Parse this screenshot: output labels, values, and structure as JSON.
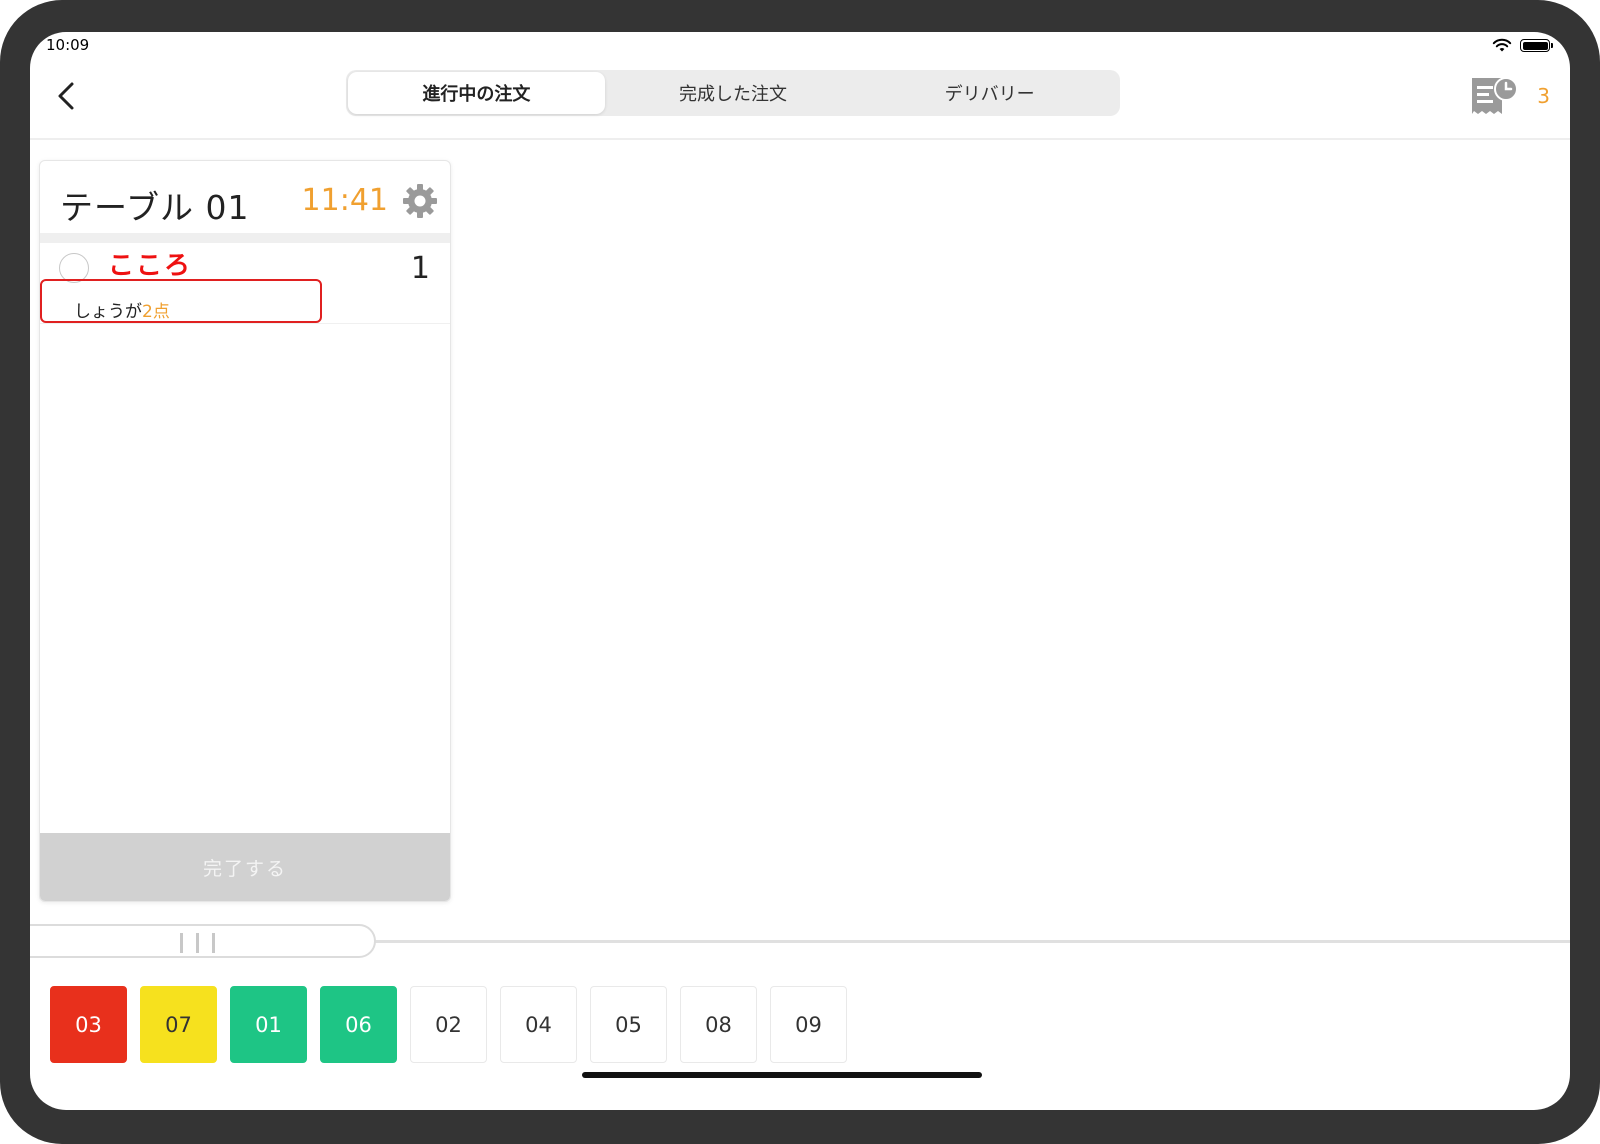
{
  "status_bar": {
    "time": "10:09"
  },
  "header": {
    "tabs": [
      {
        "label": "進行中の注文",
        "active": true
      },
      {
        "label": "完成した注文",
        "active": false
      },
      {
        "label": "デリバリー",
        "active": false
      }
    ],
    "receipt_count": "3"
  },
  "order_card": {
    "title": "テーブル  01",
    "time": "11:41",
    "item": {
      "name": "こころ",
      "quantity": "1",
      "option_text": "しょうが",
      "option_count": "2点"
    },
    "complete_label": "完了する"
  },
  "table_chips": [
    {
      "label": "03",
      "status": "red"
    },
    {
      "label": "07",
      "status": "yellow"
    },
    {
      "label": "01",
      "status": "green"
    },
    {
      "label": "06",
      "status": "green"
    },
    {
      "label": "02",
      "status": "none"
    },
    {
      "label": "04",
      "status": "none"
    },
    {
      "label": "05",
      "status": "none"
    },
    {
      "label": "08",
      "status": "none"
    },
    {
      "label": "09",
      "status": "none"
    }
  ],
  "colors": {
    "accent_orange": "#f0a030",
    "item_red": "#e11111",
    "chip_red": "#e8301c",
    "chip_yellow": "#f6e11e",
    "chip_green": "#1ec585"
  },
  "icons": {
    "back": "chevron-left-icon",
    "receipt": "receipt-clock-icon",
    "settings": "gear-icon",
    "wifi": "wifi-icon",
    "battery": "battery-icon"
  }
}
